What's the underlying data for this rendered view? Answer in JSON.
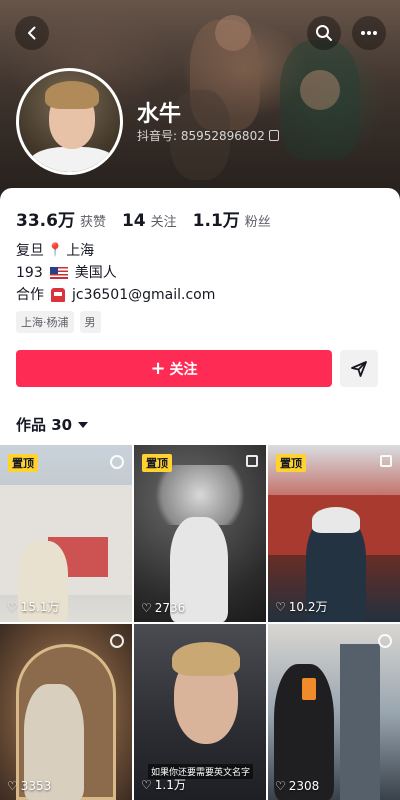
{
  "header": {
    "nickname": "水牛",
    "douyin_id_label": "抖音号: 85952896802"
  },
  "stats": [
    {
      "value": "33.6万",
      "label": "获赞"
    },
    {
      "value": "14",
      "label": "关注"
    },
    {
      "value": "1.1万",
      "label": "粉丝"
    }
  ],
  "bio": {
    "line1_text": "复旦",
    "line1_text_b": "上海",
    "line2_num": "193",
    "line2_text": "美国人",
    "line3_label": "合作",
    "line3_email": "jc36501@gmail.com"
  },
  "tags": [
    "上海·杨浦",
    "男"
  ],
  "actions": {
    "follow_label": "关注"
  },
  "works": {
    "label": "作品 30"
  },
  "videos": [
    {
      "pinned": "置顶",
      "likes": "15.1万"
    },
    {
      "pinned": "置顶",
      "likes": "2736"
    },
    {
      "pinned": "置顶",
      "likes": "10.2万"
    },
    {
      "likes": "3353"
    },
    {
      "likes": "1.1万",
      "caption": "如果你还要需要英文名字"
    },
    {
      "likes": "2308"
    }
  ],
  "colors": {
    "follow_button": "#fe2c55",
    "pinned_badge": "#ffd32f",
    "text_primary": "#161823",
    "text_secondary": "#5c5e66"
  }
}
